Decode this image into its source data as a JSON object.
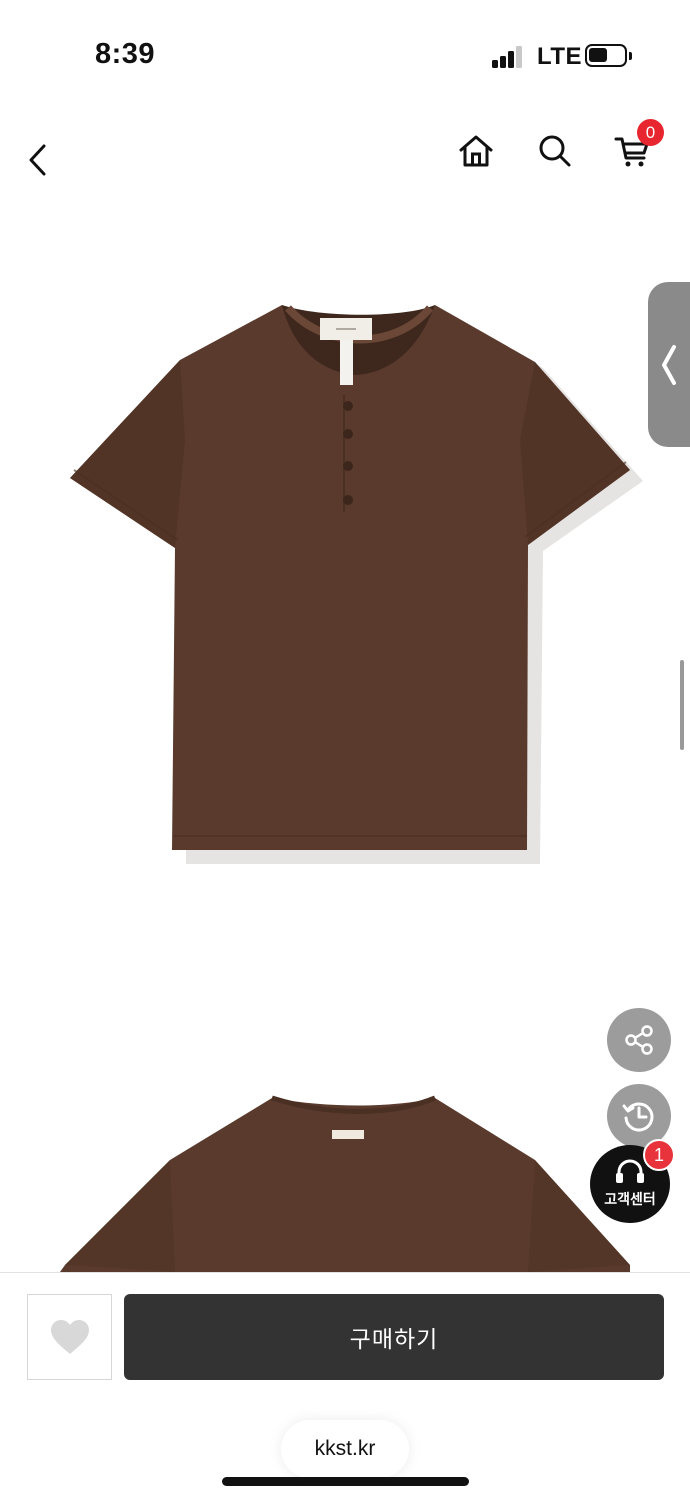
{
  "status_bar": {
    "time": "8:39",
    "network": "LTE"
  },
  "nav": {
    "back_icon": "chevron-left-icon",
    "home_icon": "home-icon",
    "search_icon": "search-icon",
    "cart_icon": "cart-icon",
    "cart_count": "0"
  },
  "product": {
    "color": "#5a3a2c",
    "images": [
      "front-view",
      "back-view"
    ]
  },
  "side_tab": {
    "icon": "chevron-left-icon"
  },
  "floating": {
    "share_icon": "share-icon",
    "recent_icon": "history-icon",
    "support_label": "고객센터",
    "support_badge": "1"
  },
  "bottom_bar": {
    "wishlist_icon": "heart-icon",
    "buy_label": "구매하기"
  },
  "browser": {
    "url": "kkst.kr"
  },
  "colors": {
    "badge_red": "#e8262f",
    "buy_button": "#333333",
    "floating_gray": "#9c9c9c"
  }
}
